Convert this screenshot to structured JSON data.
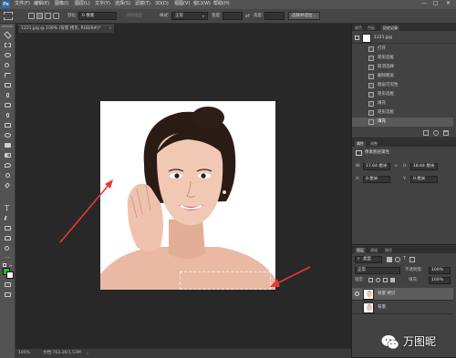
{
  "app": {
    "logo": "Ps",
    "window_controls": [
      "—",
      "□",
      "✕"
    ]
  },
  "menu": [
    "文件(F)",
    "编辑(E)",
    "图像(I)",
    "图层(L)",
    "文字(Y)",
    "选择(S)",
    "滤镜(T)",
    "3D(D)",
    "视图(V)",
    "窗口(W)",
    "帮助(H)"
  ],
  "options": {
    "feather_label": "羽化:",
    "feather_value": "0 像素",
    "antialias_label": "消除锯齿",
    "style_label": "样式:",
    "style_value": "正常",
    "width_label": "宽度:",
    "height_label": "高度:",
    "select_mask_button": "选择并遮住..."
  },
  "document": {
    "tab_title": "1221.jpg @ 100% (背景 拷贝, RGB/8#)*",
    "tab_close": "×"
  },
  "status": {
    "zoom": "100%",
    "doc_info": "文档:763.2K/1.53M"
  },
  "history_panel": {
    "tabs": [
      "颜色",
      "色板",
      "历史记录"
    ],
    "active_tab": "历史记录",
    "snapshot_name": "1221.jpg",
    "items": [
      "打开",
      "矩形选框",
      "取消选择",
      "删除图层",
      "图层可见性",
      "矩形选框",
      "填充",
      "矩形选框",
      "填充"
    ]
  },
  "properties_panel": {
    "tabs": [
      "属性",
      "调整"
    ],
    "subtitle": "像素图层属性",
    "w_label": "W:",
    "w_value": "17.64 厘米",
    "h_label": "H:",
    "h_value": "18.64 厘米",
    "x_label": "X:",
    "x_value": "0 厘米",
    "y_label": "Y:",
    "y_value": "0 厘米"
  },
  "layers_panel": {
    "tabs": [
      "图层",
      "通道",
      "路径"
    ],
    "kind_filter": "类型",
    "blend_mode": "正常",
    "opacity_label": "不透明度:",
    "opacity_value": "100%",
    "lock_label": "锁定:",
    "fill_label": "填充:",
    "fill_value": "100%",
    "layers": [
      {
        "name": "背景 拷贝",
        "visible": true,
        "selected": true
      },
      {
        "name": "背景",
        "visible": false,
        "selected": false
      }
    ]
  },
  "watermark": {
    "text": "万图昵"
  },
  "colors": {
    "accent_blue": "#2b6cb3",
    "arrow_red": "#e53935",
    "foreground_swatch": "#22c02a",
    "panel_bg": "#424242"
  }
}
